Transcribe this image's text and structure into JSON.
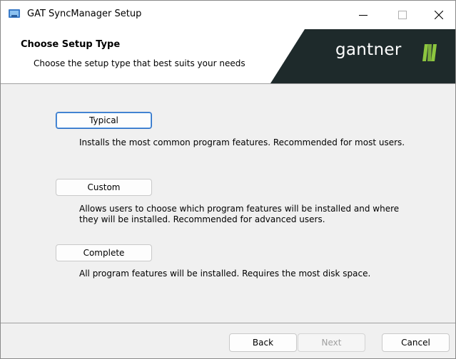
{
  "window": {
    "title": "GAT SyncManager Setup"
  },
  "banner": {
    "title": "Choose Setup Type",
    "subtitle": "Choose the setup type that best suits your needs",
    "brand": "gantner",
    "brand_color": "#1e2a2b",
    "mark_color": "#8dc63f"
  },
  "options": [
    {
      "label": "Typical",
      "description": "Installs the most common program features. Recommended for most users."
    },
    {
      "label": "Custom",
      "description_lines": [
        "Allows users to choose which program features will be installed and where",
        "they will be installed. Recommended for advanced users."
      ]
    },
    {
      "label": "Complete",
      "description": "All program features will be installed. Requires the most disk space."
    }
  ],
  "footer": {
    "back_label": "Back",
    "next_label": "Next",
    "cancel_label": "Cancel"
  }
}
